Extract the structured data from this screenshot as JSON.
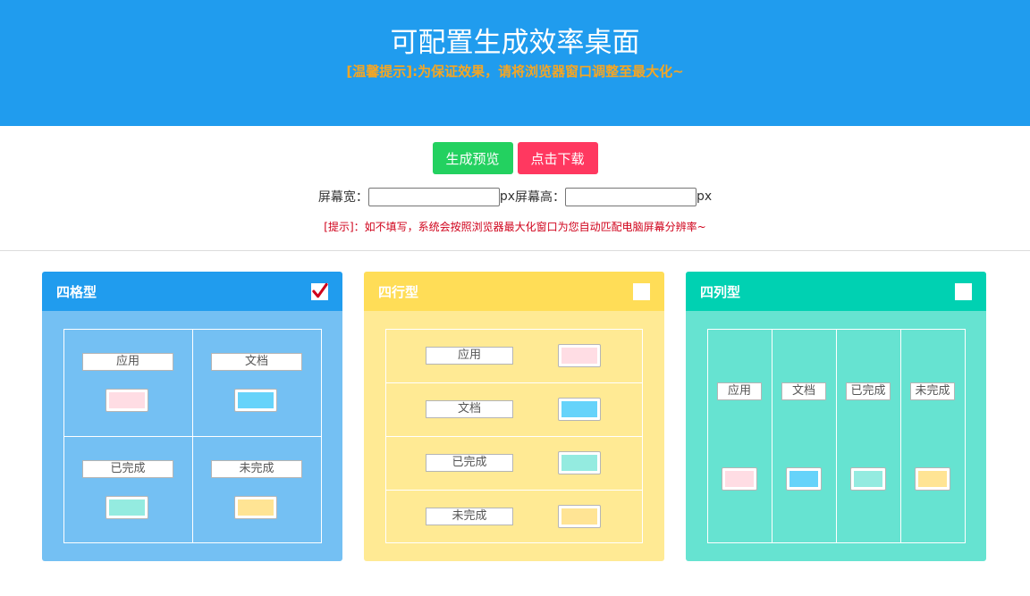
{
  "header": {
    "title": "可配置生成效率桌面",
    "tip": "[温馨提示]:为保证效果，请将浏览器窗口调整至最大化~"
  },
  "controls": {
    "preview_label": "生成预览",
    "download_label": "点击下载",
    "width_label": "屏幕宽：",
    "height_label": "屏幕高：",
    "unit": "px",
    "width_value": "",
    "height_value": "",
    "hint": "[提示]：如不填写，系统会按照浏览器最大化窗口为您自动匹配电脑屏幕分辨率~"
  },
  "colors": {
    "app": "#ffdde4",
    "doc": "#66d3fa",
    "done": "#94ebe0",
    "todo": "#ffe494"
  },
  "cards": [
    {
      "title": "四格型",
      "checked": true,
      "labels": [
        "应用",
        "文档",
        "已完成",
        "未完成"
      ]
    },
    {
      "title": "四行型",
      "checked": false,
      "labels": [
        "应用",
        "文档",
        "已完成",
        "未完成"
      ]
    },
    {
      "title": "四列型",
      "checked": false,
      "labels": [
        "应用",
        "文档",
        "已完成",
        "未完成"
      ]
    }
  ]
}
